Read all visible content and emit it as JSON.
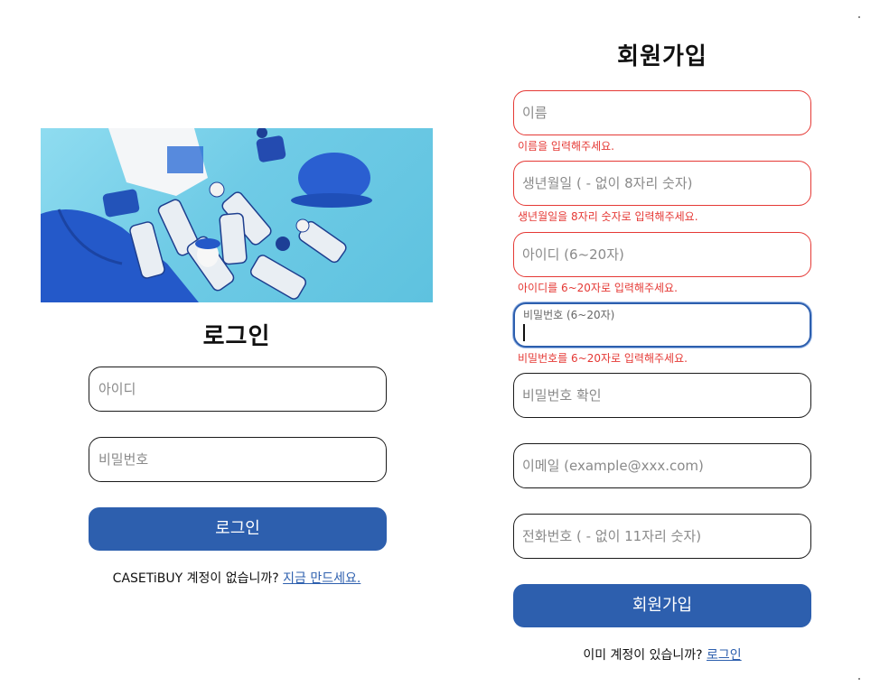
{
  "login": {
    "title": "로그인",
    "id_placeholder": "아이디",
    "password_placeholder": "비밀번호",
    "submit_label": "로그인",
    "no_account_text": "CASETiBUY 계정이 없습니까?",
    "create_link": "지금 만드세요."
  },
  "signup": {
    "title": "회원가입",
    "fields": [
      {
        "placeholder": "이름",
        "error": "이름을 입력해주세요."
      },
      {
        "placeholder": "생년월일 ( - 없이 8자리 숫자)",
        "error": "생년월일을 8자리 숫자로 입력해주세요."
      },
      {
        "placeholder": "아이디 (6~20자)",
        "error": "아이디를 6~20자로 입력해주세요."
      },
      {
        "label": "비밀번호 (6~20자)",
        "error": "비밀번호를 6~20자로 입력해주세요."
      },
      {
        "placeholder": "비밀번호 확인"
      },
      {
        "placeholder": "이메일 (example@xxx.com)"
      },
      {
        "placeholder": "전화번호 ( - 없이 11자리 숫자)"
      }
    ],
    "submit_label": "회원가입",
    "have_account_text": "이미 계정이 있습니까?",
    "login_link": "로그인"
  },
  "colors": {
    "primary": "#2d5fae",
    "error": "#e53935",
    "hero_bg": "#6fcbe6"
  }
}
